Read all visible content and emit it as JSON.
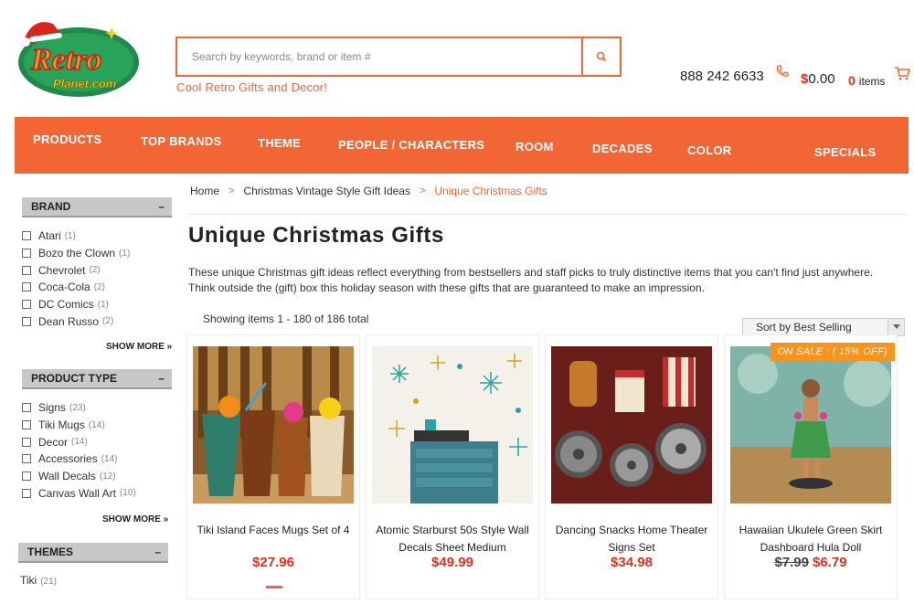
{
  "header": {
    "logo_text_top": "Retro",
    "logo_text_bottom": "Planet.com",
    "search_placeholder": "Search by keywords, brand or item #",
    "tagline": "Cool Retro Gifts and Decor!",
    "phone": "888 242 6633",
    "cart_total": "0.00",
    "cart_currency": "$",
    "cart_count": "0",
    "cart_items_label": "items"
  },
  "nav": {
    "items": [
      {
        "label": "PRODUCTS"
      },
      {
        "label": "TOP BRANDS"
      },
      {
        "label": "THEME"
      },
      {
        "label": "PEOPLE / CHARACTERS"
      },
      {
        "label": "ROOM"
      },
      {
        "label": "DECADES"
      },
      {
        "label": "COLOR"
      },
      {
        "label": "SPECIALS"
      }
    ]
  },
  "sidebar": {
    "brand": {
      "title": "BRAND",
      "toggle": "–",
      "items": [
        {
          "label": "Atari",
          "count": "(1)"
        },
        {
          "label": "Bozo the Clown",
          "count": "(1)"
        },
        {
          "label": "Chevrolet",
          "count": "(2)"
        },
        {
          "label": "Coca-Cola",
          "count": "(2)"
        },
        {
          "label": "DC Comics",
          "count": "(1)"
        },
        {
          "label": "Dean Russo",
          "count": "(2)"
        }
      ],
      "show_more": "SHOW MORE »"
    },
    "product_type": {
      "title": "PRODUCT TYPE",
      "toggle": "–",
      "items": [
        {
          "label": "Signs",
          "count": "(23)"
        },
        {
          "label": "Tiki Mugs",
          "count": "(14)"
        },
        {
          "label": "Decor",
          "count": "(14)"
        },
        {
          "label": "Accessories",
          "count": "(14)"
        },
        {
          "label": "Wall Decals",
          "count": "(12)"
        },
        {
          "label": "Canvas Wall Art",
          "count": "(10)"
        }
      ],
      "show_more": "SHOW MORE »"
    },
    "themes": {
      "title": "THEMES",
      "toggle": "–",
      "first_item": "Tiki",
      "first_count": "(21)"
    }
  },
  "main": {
    "breadcrumb": {
      "home": "Home",
      "parent": "Christmas Vintage Style Gift Ideas",
      "current": "Unique Christmas Gifts",
      "separator": ">"
    },
    "title": "Unique Christmas Gifts",
    "intro": "These unique Christmas gift ideas reflect everything from bestsellers and staff picks to truly distinctive items that you can't find just anywhere. Think outside the (gift) box this holiday season with these gifts that are guaranteed to make an impression.",
    "showing": "Showing items 1 - 180 of 186 total",
    "sort_label": "Sort by Best Selling"
  },
  "products": [
    {
      "name": "Tiki Island Faces Mugs Set of 4",
      "price": "$27.96",
      "old_price": "",
      "badge": ""
    },
    {
      "name": "Atomic Starburst 50s Style Wall Decals Sheet Medium",
      "price": "$49.99",
      "old_price": "",
      "badge": ""
    },
    {
      "name": "Dancing Snacks Home Theater Signs Set",
      "price": "$34.98",
      "old_price": "",
      "badge": ""
    },
    {
      "name": "Hawaiian Ukulele Green Skirt Dashboard Hula Doll",
      "price": "$6.79",
      "old_price": "$7.99",
      "badge": "ON SALE : ( 15% OFF)"
    }
  ],
  "colors": {
    "accent": "#f26535",
    "price": "#e0301e",
    "badge": "#f7941d",
    "facet_header": "#c8c8c8"
  }
}
